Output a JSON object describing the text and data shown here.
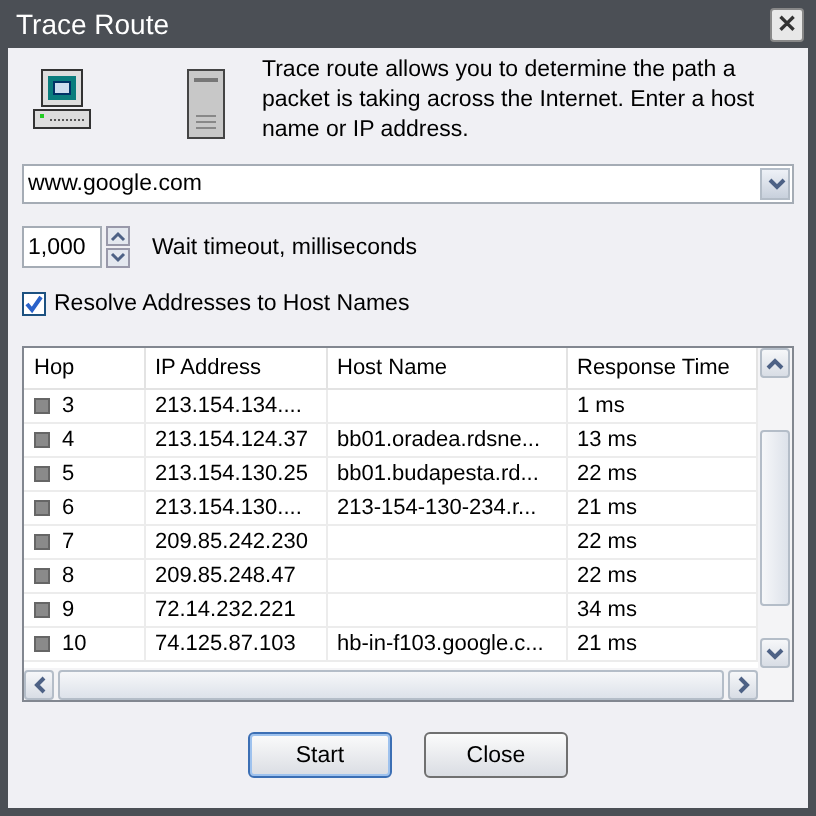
{
  "window": {
    "title": "Trace Route",
    "close": "✕"
  },
  "description": "Trace route allows you to determine the path a packet is taking across the Internet. Enter a host name or IP address.",
  "host_field": {
    "value": "www.google.com"
  },
  "timeout": {
    "value": "1,000",
    "label": "Wait timeout, milliseconds"
  },
  "resolve_checkbox": {
    "label": "Resolve Addresses to Host Names",
    "checked": true
  },
  "table": {
    "columns": [
      "Hop",
      "IP Address",
      "Host Name",
      "Response Time"
    ],
    "rows": [
      {
        "hop": "3",
        "ip": "213.154.134....",
        "time": "1 ms",
        "color": "#8a8a8a"
      },
      {
        "hop": "4",
        "ip": "213.154.124.37",
        "host": "bb01.oradea.rdsne...",
        "time": "13 ms",
        "color": "#8a8a8a"
      },
      {
        "hop": "5",
        "ip": "213.154.130.25",
        "host": "bb01.budapesta.rd...",
        "time": "22 ms",
        "color": "#8a8a8a"
      },
      {
        "hop": "6",
        "ip": "213.154.130....",
        "host": "213-154-130-234.r...",
        "time": "21 ms",
        "color": "#8a8a8a"
      },
      {
        "hop": "7",
        "ip": "209.85.242.230",
        "time": "22 ms",
        "color": "#8a8a8a"
      },
      {
        "hop": "8",
        "ip": "209.85.248.47",
        "time": "22 ms",
        "color": "#8a8a8a"
      },
      {
        "hop": "9",
        "ip": "72.14.232.221",
        "time": "34 ms",
        "color": "#8a8a8a"
      },
      {
        "hop": "10",
        "ip": "74.125.87.103",
        "host": "hb-in-f103.google.c...",
        "time": "21 ms",
        "color": "#8a8a8a"
      }
    ]
  },
  "buttons": [
    {
      "label": "Start",
      "default": true
    },
    {
      "label": "Close",
      "default": false
    }
  ]
}
